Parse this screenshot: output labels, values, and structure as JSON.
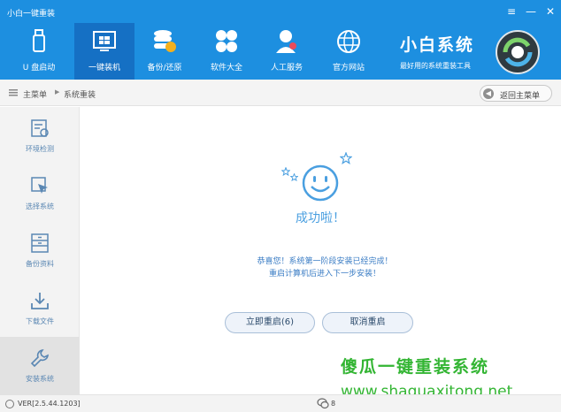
{
  "window": {
    "title": "小白一键重装",
    "controls": [
      "≡",
      "—",
      "✕"
    ]
  },
  "nav": {
    "items": [
      {
        "label": "U 盘启动",
        "icon": "usb-icon"
      },
      {
        "label": "一键装机",
        "icon": "windows-icon"
      },
      {
        "label": "备份/还原",
        "icon": "database-icon"
      },
      {
        "label": "软件大全",
        "icon": "apps-icon"
      },
      {
        "label": "人工服务",
        "icon": "support-person-icon"
      },
      {
        "label": "官方网站",
        "icon": "globe-icon"
      }
    ],
    "active_index": 1
  },
  "brand": {
    "name": "小白系统",
    "slogan": "最好用的系统重装工具"
  },
  "breadcrumb": {
    "root": "主菜单",
    "current": "系统重装",
    "back_button": "返回主菜单"
  },
  "sidebar": {
    "items": [
      {
        "label": "环境检测",
        "icon": "checklist-icon"
      },
      {
        "label": "选择系统",
        "icon": "cursor-select-icon"
      },
      {
        "label": "备份资料",
        "icon": "cabinet-icon"
      },
      {
        "label": "下载文件",
        "icon": "download-icon"
      },
      {
        "label": "安装系统",
        "icon": "wrench-icon"
      }
    ],
    "active_index": 4
  },
  "main": {
    "success_title": "成功啦！",
    "message_line1": "恭喜您！系统第一阶段安装已经完成！",
    "message_line2": "重启计算机后进入下一步安装！",
    "restart_button": "立即重启(6)",
    "cancel_button": "取消重启"
  },
  "watermark": {
    "title": "傻瓜一键重装系统",
    "url": "www.shaguaxitong.net"
  },
  "footer": {
    "version": "VER[2.5.44.1203]",
    "chat_partial": "8"
  },
  "colors": {
    "header": "#1d8fe0",
    "active_nav": "#1570c4",
    "accent_text": "#4a9fe0",
    "watermark": "#33b533"
  }
}
